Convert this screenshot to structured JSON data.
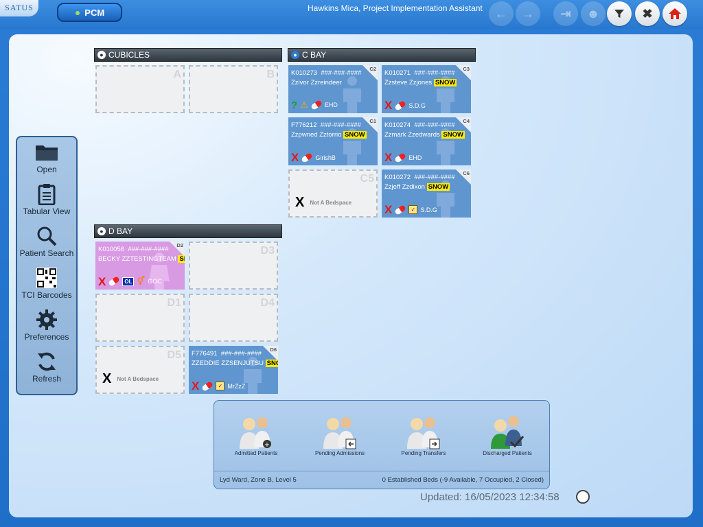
{
  "app": {
    "logo_text": "SATUS",
    "module_button": "PCM",
    "user_title": "Hawkins Mica, Project Implementation Assistant"
  },
  "toolbar_icons": [
    "back-arrow-icon",
    "forward-arrow-icon",
    "logout-icon",
    "user-swap-icon",
    "filter-icon",
    "close-icon",
    "home-icon"
  ],
  "sidebar": {
    "items": [
      {
        "label": "Open",
        "icon": "folder-icon"
      },
      {
        "label": "Tabular View",
        "icon": "clipboard-icon"
      },
      {
        "label": "Patient Search",
        "icon": "magnifier-icon"
      },
      {
        "label": "TCI Barcodes",
        "icon": "qr-code-icon"
      },
      {
        "label": "Preferences",
        "icon": "gear-icon"
      },
      {
        "label": "Refresh",
        "icon": "refresh-icon"
      }
    ]
  },
  "sections": {
    "cubicles": {
      "title": "CUBICLES"
    },
    "cbay": {
      "title": "C BAY"
    },
    "dbay": {
      "title": "D BAY"
    }
  },
  "beds": {
    "A": {
      "code": "A"
    },
    "B": {
      "code": "B"
    },
    "C2": {
      "code": "C2",
      "id": "K010273",
      "nhs": "###-###-####",
      "name": "Zzivor Zzreindeer",
      "snow": "",
      "team": "EHD"
    },
    "C3": {
      "code": "C3",
      "id": "K010271",
      "nhs": "###-###-####",
      "name": "Zzsteve Zzjones",
      "snow": "SNOW",
      "team": "S.D.G"
    },
    "C1": {
      "code": "C1",
      "id": "F776212",
      "nhs": "###-###-####",
      "name": "Zzpwned Zztorrio",
      "snow": "SNOW",
      "team": "GirishB"
    },
    "C4": {
      "code": "C4",
      "id": "K010274",
      "nhs": "###-###-####",
      "name": "Zzmark Zzedwards",
      "snow": "SNOW",
      "team": "EHD"
    },
    "C5": {
      "code": "C5",
      "na": "Not A Bedspace"
    },
    "C6": {
      "code": "C6",
      "id": "K010272",
      "nhs": "###-###-####",
      "name": "Zzjeff Zzdixon",
      "snow": "SNOW",
      "team": "S.D.G"
    },
    "D2": {
      "code": "D2",
      "id": "K010056",
      "nhs": "###-###-####",
      "name": "BECKY ZZTESTINGTEAM",
      "snow": "SN",
      "team": "GOC",
      "ol": "OL"
    },
    "D3": {
      "code": "D3"
    },
    "D1": {
      "code": "D1"
    },
    "D4": {
      "code": "D4"
    },
    "D5": {
      "code": "D5",
      "na": "Not A Bedspace"
    },
    "D6": {
      "code": "D6",
      "id": "F776491",
      "nhs": "###-###-####",
      "name": "ZZEDDIE ZZSENJUTSU",
      "snow": "SNO",
      "team": "MrZzZ"
    }
  },
  "bottom": {
    "items": [
      {
        "label": "Admitted Patients"
      },
      {
        "label": "Pending Admissions"
      },
      {
        "label": "Pending Transfers"
      },
      {
        "label": "Discharged Patients"
      }
    ],
    "location": "Lyd Ward, Zone B, Level 5",
    "beds_summary": "0 Established Beds (-9 Available, 7 Occupied, 2 Closed)"
  },
  "updated": "Updated: 16/05/2023 12:34:58"
}
